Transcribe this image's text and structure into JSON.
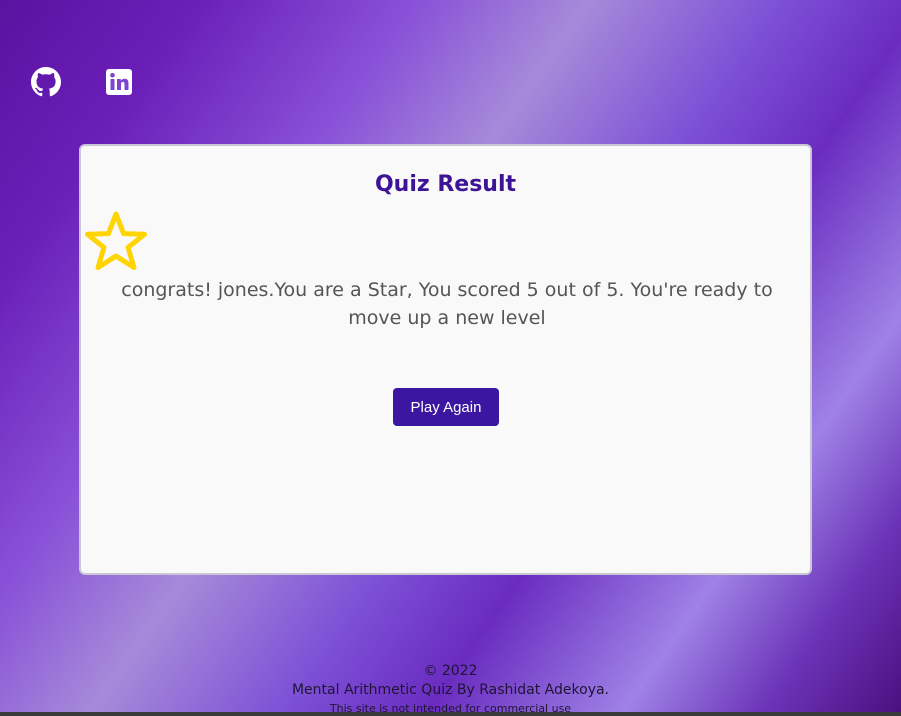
{
  "social": {
    "github": {
      "icon": "github-icon"
    },
    "linkedin": {
      "icon": "linkedin-icon"
    }
  },
  "card": {
    "title": "Quiz Result",
    "star_icon": "star-icon",
    "message": "congrats! jones.You are a Star, You scored 5 out of 5. You're ready to move up a new level",
    "button_label": "Play Again"
  },
  "footer": {
    "copyright": "© 2022",
    "credit": "Mental Arithmetic Quiz By Rashidat Adekoya.",
    "disclaimer": "This site is not intended for commercial use"
  },
  "colors": {
    "accent": "#3a16a1",
    "title": "#3d1496",
    "star": "#ffd400"
  }
}
